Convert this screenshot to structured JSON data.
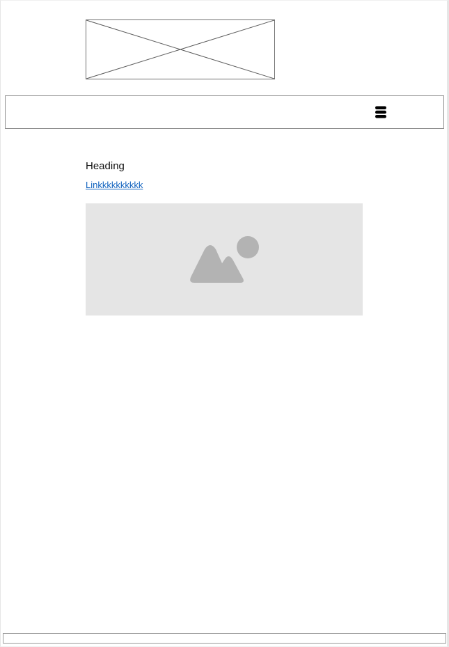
{
  "header": {
    "logo_icon": "image-placeholder-x-icon",
    "menu_icon": "hamburger-menu-icon"
  },
  "content": {
    "heading": "Heading",
    "link_text": "Linkkkkkkkkkk",
    "image_icon": "image-placeholder-icon"
  },
  "colors": {
    "link": "#1565c0",
    "image_placeholder_bg": "#e5e5e5",
    "image_placeholder_glyph": "#b3b3b3",
    "border": "#8f8f8f"
  }
}
